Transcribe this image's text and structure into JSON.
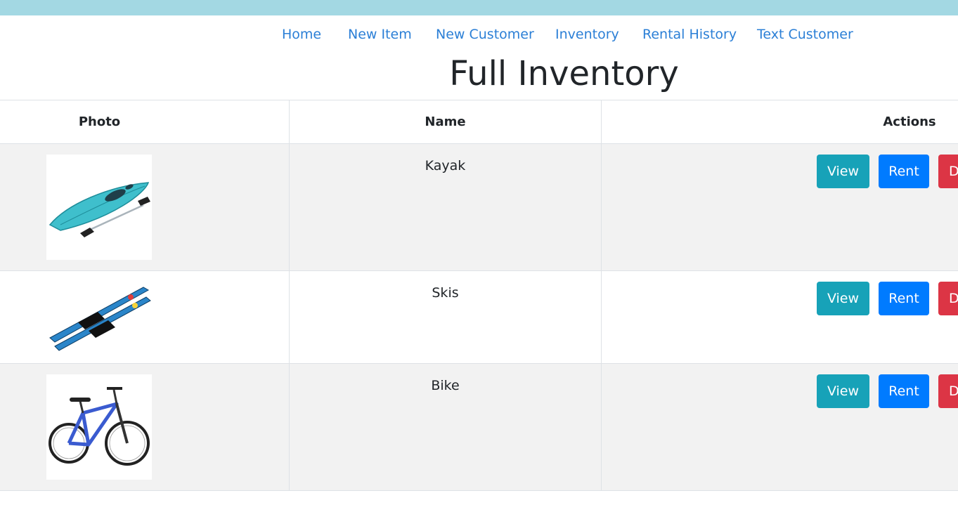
{
  "nav": {
    "items": [
      "Home",
      "New Item",
      "New Customer",
      "Inventory",
      "Rental History",
      "Text Customer"
    ]
  },
  "page_title": "Full Inventory",
  "table": {
    "headers": {
      "photo": "Photo",
      "name": "Name",
      "actions": "Actions"
    },
    "rows": [
      {
        "name": "Kayak",
        "photo_icon": "kayak-photo",
        "view": "View",
        "rent": "Rent",
        "delete": "D"
      },
      {
        "name": "Skis",
        "photo_icon": "skis-photo",
        "view": "View",
        "rent": "Rent",
        "delete": "D"
      },
      {
        "name": "Bike",
        "photo_icon": "bike-photo",
        "view": "View",
        "rent": "Rent",
        "delete": "D"
      }
    ]
  },
  "colors": {
    "topbar": "#a3d8e3",
    "link": "#2b7fd6",
    "view_button": "#17a2b8",
    "rent_button": "#007bff",
    "delete_button": "#dc3545"
  }
}
